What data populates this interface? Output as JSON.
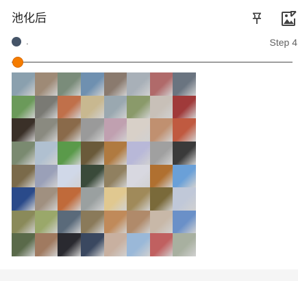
{
  "card": {
    "title": "池化后",
    "run_name": ".",
    "step_label": "Step 4",
    "slider_value_fraction": 0.0,
    "run_color": "#455468",
    "accent_color": "#f57c00"
  },
  "icons": {
    "pin": "pin-icon",
    "expand": "fullscreen-image-icon"
  },
  "image_grid": {
    "rows": 8,
    "cols": 8,
    "tile_colors": [
      [
        "#8aa0ae",
        "#9e8a76",
        "#7a8c7a",
        "#6f90b0",
        "#8a7a6e",
        "#a8b0b8",
        "#b06a6a",
        "#6a7480"
      ],
      [
        "#6b9a5a",
        "#7a7a74",
        "#c0704a",
        "#c8b890",
        "#9aa8b0",
        "#8a9a6a",
        "#c8c0b8",
        "#a03a3a"
      ],
      [
        "#3a3028",
        "#8a8a80",
        "#8a6a4a",
        "#9a9a9a",
        "#c0a0b0",
        "#d8d0c8",
        "#c09070",
        "#c05a40"
      ],
      [
        "#7a8a70",
        "#b0c0d0",
        "#5a9a4a",
        "#6a5a3a",
        "#b07a40",
        "#b8b8d8",
        "#a0a0a0",
        "#3a3a3a"
      ],
      [
        "#7a6a4a",
        "#9aa0b8",
        "#d0d8e8",
        "#3a4a3a",
        "#908060",
        "#d8d8e0",
        "#b07030",
        "#6aa0d8"
      ],
      [
        "#2a4a8a",
        "#a09080",
        "#c06a3a",
        "#9aa0a0",
        "#e0c890",
        "#a08a5a",
        "#7a6a3a",
        "#c0c8d8"
      ],
      [
        "#8a8a5a",
        "#9aa86a",
        "#5a6a7a",
        "#8a7a5a",
        "#c08a5a",
        "#b08a6a",
        "#c8b8a8",
        "#6a90c8"
      ],
      [
        "#5a6a4a",
        "#a07a60",
        "#2a2a30",
        "#3a4860",
        "#c8b0a0",
        "#9ab8d8",
        "#c06060",
        "#a8b0a0"
      ]
    ]
  }
}
